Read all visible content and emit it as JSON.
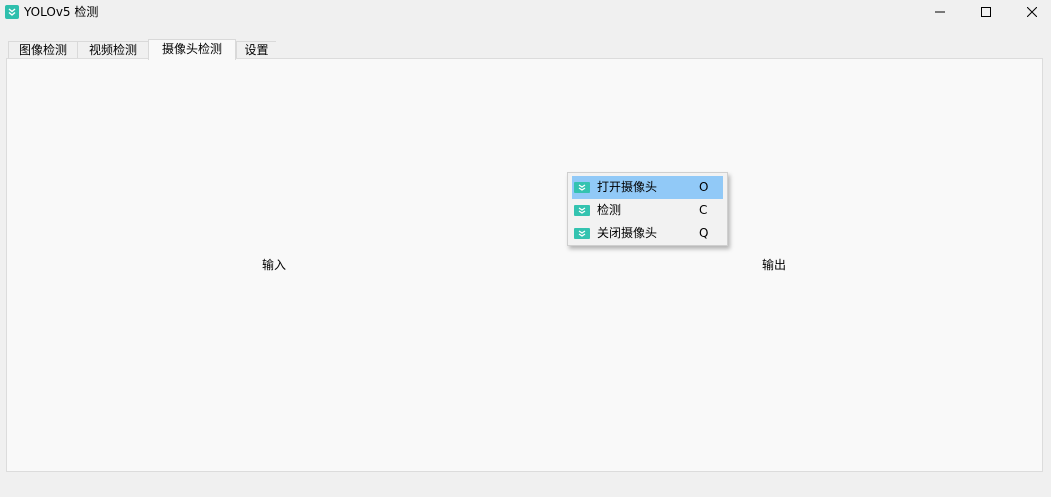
{
  "window": {
    "title": "YOLOv5 检测",
    "accent_color": "#2fbfad",
    "controls": [
      "minimize-icon",
      "maximize-icon",
      "close-icon"
    ]
  },
  "tabs": [
    {
      "label": "图像检测",
      "active": false
    },
    {
      "label": "视频检测",
      "active": false
    },
    {
      "label": "摄像头检测",
      "active": true
    },
    {
      "label": "设置",
      "active": false
    }
  ],
  "panel": {
    "input_label": "输入",
    "output_label": "输出"
  },
  "context_menu": {
    "highlight_color": "#91c9f7",
    "items": [
      {
        "label": "打开摄像头",
        "shortcut": "O",
        "icon": "app-logo-icon",
        "highlighted": true
      },
      {
        "label": "检测",
        "shortcut": "C",
        "icon": "app-logo-icon",
        "highlighted": false
      },
      {
        "label": "关闭摄像头",
        "shortcut": "Q",
        "icon": "app-logo-icon",
        "highlighted": false
      }
    ]
  }
}
